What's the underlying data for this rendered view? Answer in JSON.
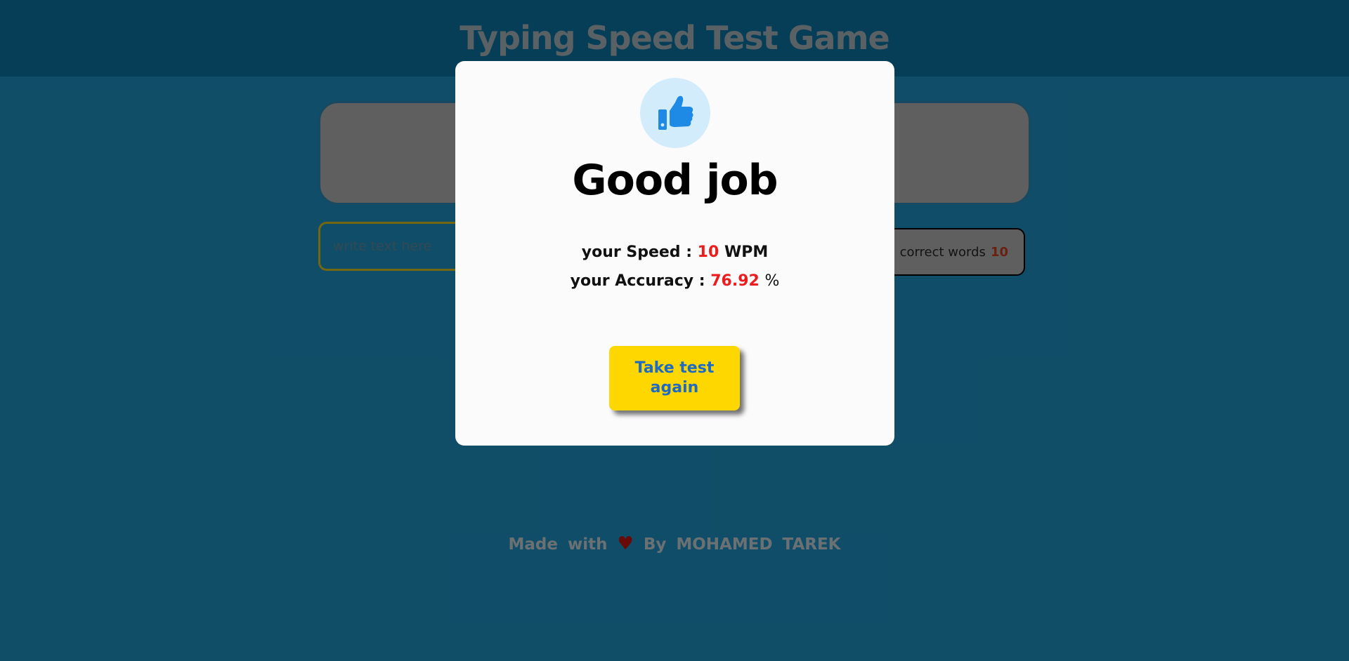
{
  "header": {
    "title": "Typing Speed Test Game"
  },
  "input": {
    "placeholder": "write text here"
  },
  "stats_box": {
    "label": "correct words",
    "count": "10"
  },
  "footer": {
    "made_with": "Made with",
    "heart": "♥",
    "by": "By MOHAMED TAREK"
  },
  "modal": {
    "icon": "thumbs-up-icon",
    "title": "Good job",
    "speed_label": "your Speed :",
    "speed_value": "10",
    "speed_unit": "WPM",
    "accuracy_label": "your Accuracy :",
    "accuracy_value": "76.92",
    "accuracy_unit": "%",
    "button_label": "Take test again"
  },
  "colors": {
    "page_bg": "#1c86b4",
    "header_bg": "#0b6b97",
    "accent_value": "#ec1c1c",
    "button_bg": "#ffd700",
    "button_text": "#1f6bc2",
    "icon_blue": "#1e8ae6"
  }
}
